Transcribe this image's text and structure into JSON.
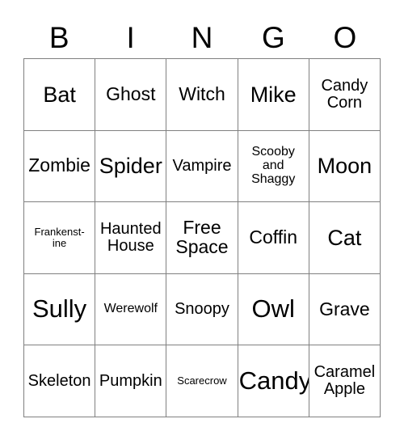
{
  "card": {
    "title": "BINGO",
    "header_letters": [
      "B",
      "I",
      "N",
      "G",
      "O"
    ],
    "columns": 5,
    "rows": 5,
    "border_color": "#808080",
    "background_color": "#ffffff",
    "text_color": "#000000"
  },
  "grid": {
    "row1": [
      {
        "label": "Bat",
        "size": "fs-lg"
      },
      {
        "label": "Ghost",
        "size": "fs-md"
      },
      {
        "label": "Witch",
        "size": "fs-md"
      },
      {
        "label": "Mike",
        "size": "fs-lg"
      },
      {
        "label": "Candy\nCorn",
        "size": "fs-sm"
      }
    ],
    "row2": [
      {
        "label": "Zombie",
        "size": "fs-md"
      },
      {
        "label": "Spider",
        "size": "fs-lg"
      },
      {
        "label": "Vampire",
        "size": "fs-sm"
      },
      {
        "label": "Scooby\nand\nShaggy",
        "size": "fs-xs"
      },
      {
        "label": "Moon",
        "size": "fs-lg"
      }
    ],
    "row3": [
      {
        "label": "Frankenst-\nine",
        "size": "fs-xxs"
      },
      {
        "label": "Haunted\nHouse",
        "size": "fs-sm"
      },
      {
        "label": "Free\nSpace",
        "size": "fs-md"
      },
      {
        "label": "Coffin",
        "size": "fs-md"
      },
      {
        "label": "Cat",
        "size": "fs-lg"
      }
    ],
    "row4": [
      {
        "label": "Sully",
        "size": "fs-xl"
      },
      {
        "label": "Werewolf",
        "size": "fs-xs"
      },
      {
        "label": "Snoopy",
        "size": "fs-sm"
      },
      {
        "label": "Owl",
        "size": "fs-xl"
      },
      {
        "label": "Grave",
        "size": "fs-md"
      }
    ],
    "row5": [
      {
        "label": "Skeleton",
        "size": "fs-sm"
      },
      {
        "label": "Pumpkin",
        "size": "fs-sm"
      },
      {
        "label": "Scarecrow",
        "size": "fs-xxs"
      },
      {
        "label": "Candy",
        "size": "fs-xl"
      },
      {
        "label": "Caramel\nApple",
        "size": "fs-sm"
      }
    ]
  }
}
